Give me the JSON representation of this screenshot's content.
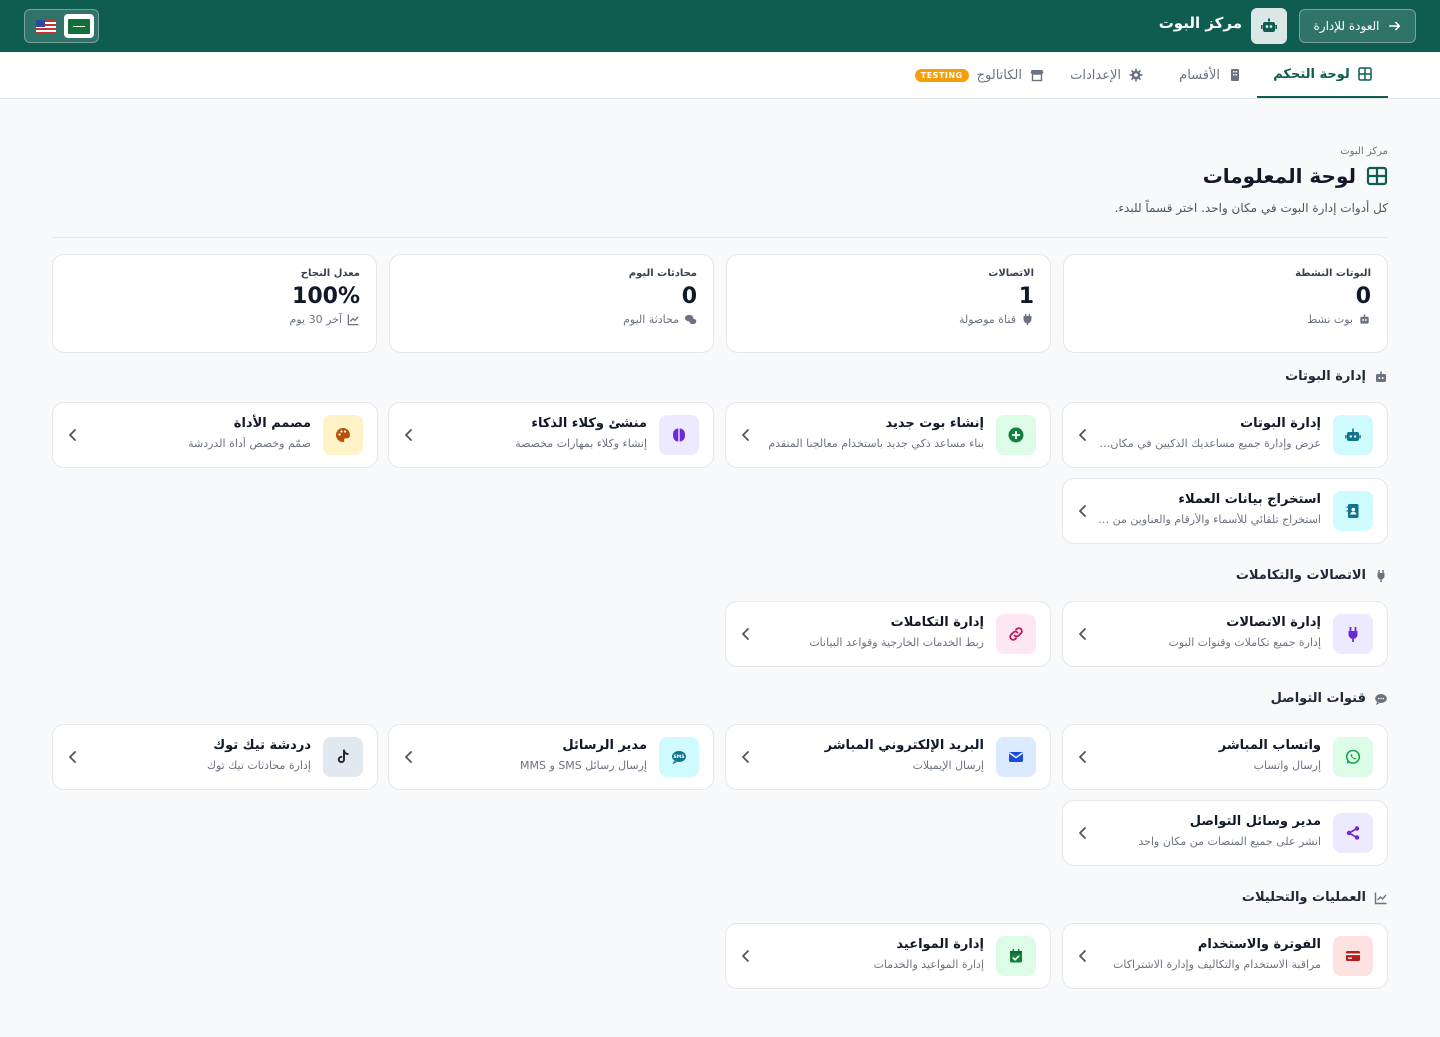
{
  "header": {
    "back_label": "العودة للإدارة",
    "title": "مركز البوت"
  },
  "tabs": [
    {
      "label": "لوحة التحكم",
      "icon": "dashboard-icon",
      "active": true
    },
    {
      "label": "الأقسام",
      "icon": "building-icon"
    },
    {
      "label": "الإعدادات",
      "icon": "gear-icon"
    },
    {
      "label": "الكاتالوج",
      "icon": "store-icon",
      "badge": "TESTING"
    }
  ],
  "page": {
    "breadcrumb": "مركز البوت",
    "title": "لوحة المعلومات",
    "subtitle": "كل أدوات إدارة البوت في مكان واحد. اختر قسماً للبدء."
  },
  "stats": [
    {
      "label": "البوتات النشطة",
      "value": "0",
      "foot": "بوت نشط",
      "icon": "robot-icon"
    },
    {
      "label": "الاتصالات",
      "value": "1",
      "foot": "قناة موصولة",
      "icon": "plug-icon"
    },
    {
      "label": "محادثات اليوم",
      "value": "0",
      "foot": "محادثة اليوم",
      "icon": "chat-icon"
    },
    {
      "label": "معدل النجاح",
      "value": "100%",
      "foot": "آخر 30 يوم",
      "icon": "chart-line-icon"
    }
  ],
  "sections": {
    "bots": {
      "title": "إدارة البوتات",
      "items": [
        {
          "title": "إدارة البوتات",
          "desc": "عرض وإدارة جميع مساعديك الذكيين في مكان واحد",
          "icon": "robot-icon"
        },
        {
          "title": "إنشاء بوت جديد",
          "desc": "بناء مساعد ذكي جديد باستخدام معالجنا المتقدم",
          "icon": "plus-circle-icon"
        },
        {
          "title": "منشئ وكلاء الذكاء",
          "desc": "إنشاء وكلاء بمهارات مخصصة",
          "icon": "brain-icon"
        },
        {
          "title": "مصمم الأداة",
          "desc": "صمّم وخصص أداة الدردشة",
          "icon": "palette-icon"
        },
        {
          "title": "استخراج بيانات العملاء",
          "desc": "استخراج تلقائي للأسماء والأرقام والعناوين من المحادثات",
          "icon": "contact-book-icon"
        }
      ]
    },
    "connections": {
      "title": "الاتصالات والتكاملات",
      "items": [
        {
          "title": "إدارة الاتصالات",
          "desc": "إدارة جميع تكاملات وقنوات البوت",
          "icon": "plug-icon"
        },
        {
          "title": "إدارة التكاملات",
          "desc": "ربط الخدمات الخارجية وقواعد البيانات",
          "icon": "link-icon"
        }
      ]
    },
    "channels": {
      "title": "قنوات التواصل",
      "items": [
        {
          "title": "واتساب المباشر",
          "desc": "إرسال واتساب",
          "icon": "whatsapp-icon"
        },
        {
          "title": "البريد الإلكتروني المباشر",
          "desc": "إرسال الإيميلات",
          "icon": "envelope-icon"
        },
        {
          "title": "مدير الرسائل",
          "desc": "إرسال رسائل SMS و MMS",
          "icon": "sms-icon"
        },
        {
          "title": "دردشة تيك توك",
          "desc": "إدارة محادثات تيك توك",
          "icon": "tiktok-icon"
        },
        {
          "title": "مدير وسائل التواصل",
          "desc": "انشر على جميع المنصات من مكان واحد",
          "icon": "share-icon"
        }
      ]
    },
    "operations": {
      "title": "العمليات والتحليلات",
      "items": [
        {
          "title": "الفوترة والاستخدام",
          "desc": "مراقبة الاستخدام والتكاليف وإدارة الاشتراكات",
          "icon": "credit-card-icon"
        },
        {
          "title": "إدارة المواعيد",
          "desc": "إدارة المواعيد والخدمات",
          "icon": "calendar-check-icon"
        }
      ]
    }
  },
  "colors": {
    "brand": "#0f5c50",
    "testing_badge": "#f59e0b"
  }
}
